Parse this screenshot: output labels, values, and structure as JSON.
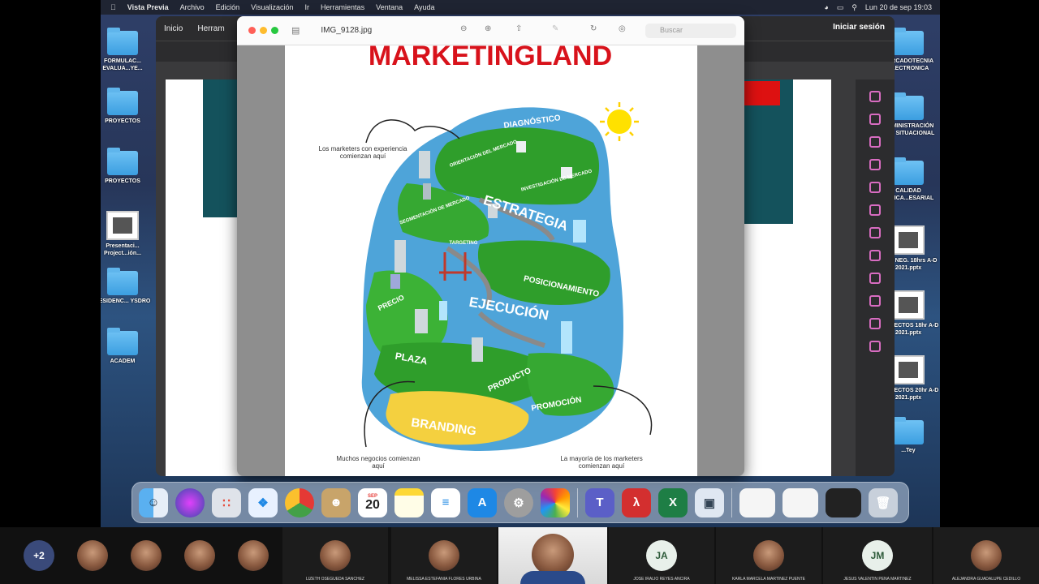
{
  "menubar": {
    "app_name": "Vista Previa",
    "items": [
      "Archivo",
      "Edición",
      "Visualización",
      "Ir",
      "Herramientas",
      "Ventana",
      "Ayuda"
    ],
    "clock": "Lun 20 de sep  19:03"
  },
  "desktop_left": [
    {
      "label": "FORMULAC... EVALUA...YE...",
      "kind": "folder"
    },
    {
      "label": "PROYECTOS",
      "kind": "folder"
    },
    {
      "label": "PROYECTOS",
      "kind": "folder"
    },
    {
      "label": "Presentaci... Project...ión...",
      "kind": "doc"
    },
    {
      "label": "RESIDENC... YSDRO",
      "kind": "folder"
    },
    {
      "label": "ACADEM",
      "kind": "folder"
    }
  ],
  "desktop_right": [
    {
      "label": "...ERCADOTECNIA ELECTRONICA",
      "kind": "folder"
    },
    {
      "label": "...OMINISTRACIÓN ...LA SITUACIONAL",
      "kind": "folder"
    },
    {
      "label": "CALIDAD APLICA...ESARIAL",
      "kind": "folder"
    },
    {
      "label": "SEM. NEG. 18hrs A-D 2021.pptx",
      "kind": "doc"
    },
    {
      "label": "PROYECTOS 18hr A-D 2021.pptx",
      "kind": "doc"
    },
    {
      "label": "PROYECTOS 20hr A-D 2021.pptx",
      "kind": "doc"
    },
    {
      "label": "...Tey",
      "kind": "folder"
    }
  ],
  "background_window": {
    "nav": [
      "Inicio",
      "Herram"
    ],
    "login_label": "Iniciar sesión"
  },
  "preview": {
    "filename": "IMG_9128.jpg",
    "search_placeholder": "Buscar",
    "map_title": "MARKETINGLAND",
    "note_top": "Los marketers con experiencia comienzan aquí",
    "note_bottom_left": "Muchos negocios comienzan aquí",
    "note_bottom_right": "La mayoría de los marketers comienzan aquí",
    "regions": [
      "DIAGNÓSTICO",
      "ORIENTACIÓN DEL MERCADO",
      "INVESTIGACIÓN DE MERCADO",
      "SEGMENTACIÓN DE MERCADO",
      "ESTRATEGIA",
      "TARGETING",
      "POSICIONAMIENTO",
      "EJECUCIÓN",
      "PRECIO",
      "PLAZA",
      "PRODUCTO",
      "PROMOCIÓN",
      "BRANDING"
    ]
  },
  "dock": {
    "calendar_month": "SEP",
    "calendar_day": "20",
    "apps": [
      "finder",
      "siri",
      "launchpad",
      "safari",
      "chrome",
      "contacts",
      "calendar",
      "notes",
      "reminders",
      "app-store",
      "system-preferences",
      "photos",
      "teams",
      "acrobat",
      "excel",
      "preview"
    ]
  },
  "participants": [
    {
      "label": "+2",
      "type": "more"
    },
    {
      "label": "",
      "type": "avatar"
    },
    {
      "label": "",
      "type": "avatar"
    },
    {
      "label": "",
      "type": "avatar"
    },
    {
      "label": "",
      "type": "avatar"
    },
    {
      "label": "LIZETH OSEGUEDA SANCHEZ",
      "type": "video"
    },
    {
      "label": "MELISSA ESTEFANIA FLORES URBINA",
      "type": "video"
    },
    {
      "label": "",
      "type": "active-speaker"
    },
    {
      "label": "JOSE IRALIO REYES ANCIRA",
      "type": "initials",
      "initials": "JA"
    },
    {
      "label": "KARLA MARCELA MARTINEZ PUENTE",
      "type": "video"
    },
    {
      "label": "JESUS VALENTIN PENA MARTINEZ",
      "type": "initials",
      "initials": "JM"
    },
    {
      "label": "ALEJANDRA GUADALUPE CEDILLO",
      "type": "video"
    }
  ]
}
